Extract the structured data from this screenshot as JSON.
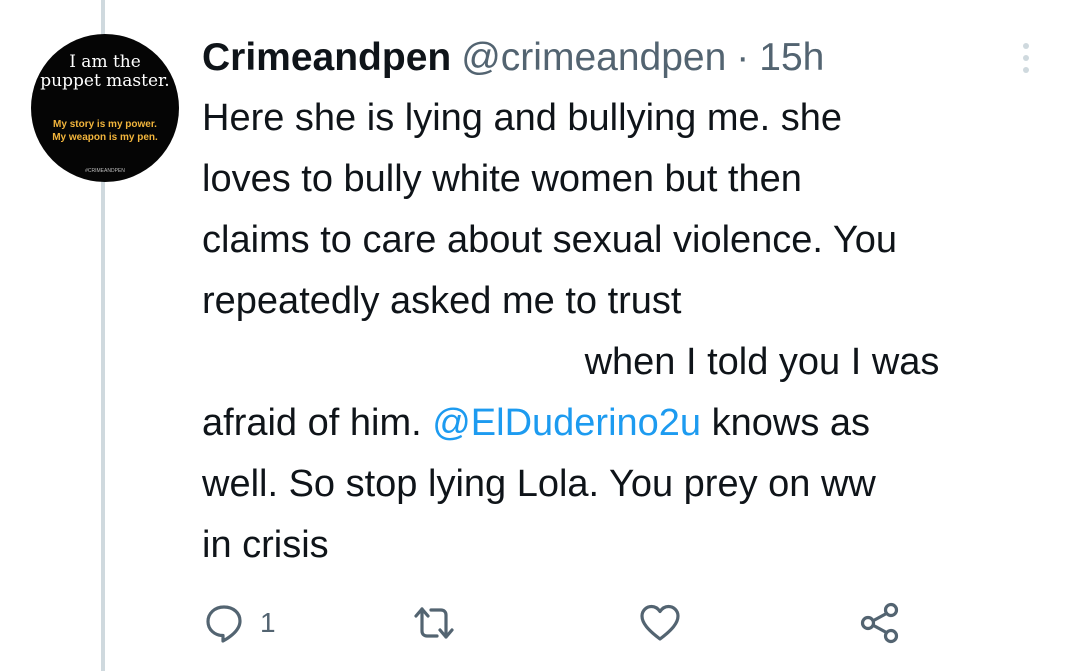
{
  "avatar": {
    "line1": "I am the",
    "line2": "puppet master.",
    "line3": "My story is my power.",
    "line4": "My weapon is my pen.",
    "line5": "#CRIMEANDPEN"
  },
  "tweet": {
    "display_name": "Crimeandpen",
    "handle": "@crimeandpen",
    "separator": "·",
    "time": "15h",
    "lines": {
      "l1": "Here she is lying and bullying me. she",
      "l2": "loves to bully white women but then",
      "l3": "claims to care about sexual violence. You",
      "l4": "repeatedly asked me to trust",
      "l5": "when I told you I was",
      "l6a": "afraid of him.",
      "l6_mention": "@ElDuderino2u",
      "l6b": "knows as",
      "l7": "well. So stop lying Lola. You prey on ww",
      "l8": "in crisis"
    }
  },
  "actions": {
    "reply_count": "1",
    "icon_color": "#536471"
  },
  "colors": {
    "link": "#1d9bf0",
    "text": "#0f1419",
    "secondary": "#536471",
    "thread_line": "#cfd9de"
  }
}
